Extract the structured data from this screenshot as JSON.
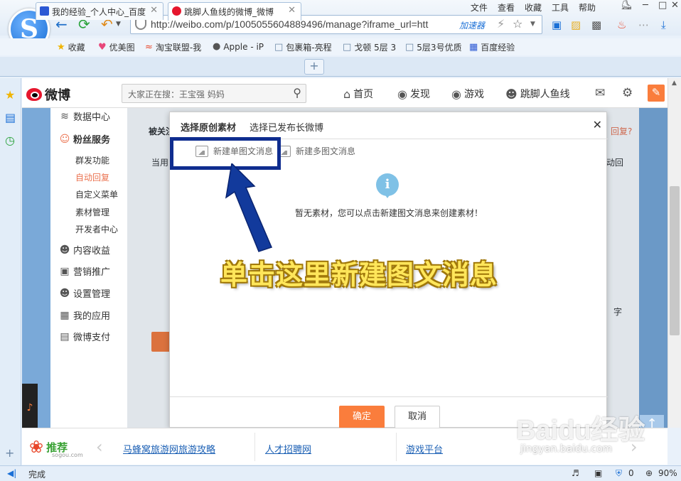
{
  "browser": {
    "menu": [
      "文件",
      "查看",
      "收藏",
      "工具",
      "帮助"
    ],
    "address": {
      "url": "http://weibo.com/p/1005055604889496/manage?iframe_url=htt",
      "accelerator": "加速器"
    },
    "bookmarks": [
      "收藏",
      "优美图",
      "淘宝联盟-我",
      "Apple - iP",
      "包裹箱-亮程",
      "戈顿 5层 3",
      "5层3号优质",
      "百度经验"
    ],
    "tabs": [
      {
        "title": "我的经验_个人中心_百度",
        "active": false
      },
      {
        "title": "跳脚人鱼线的微博_微博",
        "active": true
      }
    ],
    "status": {
      "text": "完成",
      "counter": "0",
      "zoom": "90%"
    }
  },
  "weibo": {
    "logo_text": "微博",
    "search_placeholder": "大家正在搜：王宝强 妈妈",
    "nav": {
      "home": "首页",
      "discover": "发现",
      "game": "游戏",
      "user": "跳脚人鱼线"
    },
    "menu": {
      "data_center": "数据中心",
      "fans_service": "粉丝服务",
      "fans_sub": [
        "群发功能",
        "自动回复",
        "自定义菜单",
        "素材管理",
        "开发者中心"
      ],
      "content_income": "内容收益",
      "marketing": "营销推广",
      "settings": "设置管理",
      "my_apps": "我的应用",
      "pay": "微博支付"
    },
    "behind": {
      "followed": "被关注",
      "current": "当用",
      "reply_q": "回复?",
      "auto_q": "动回",
      "chars": "字"
    }
  },
  "modal": {
    "tabs": [
      "选择原创素材",
      "选择已发布长微博"
    ],
    "new_single": "新建单图文消息",
    "new_multi": "新建多图文消息",
    "empty_message": "暂无素材，您可以点击新建图文消息来创建素材！",
    "ok": "确定",
    "cancel": "取消"
  },
  "annotation": {
    "callout": "单击这里新建图文消息",
    "box_color": "#0f2d8f",
    "text_color": "#ffe65a"
  },
  "recommend": {
    "title": "推荐",
    "source": "sogou.com",
    "links": [
      "马蜂窝旅游网旅游攻略",
      "人才招聘网",
      "游戏平台"
    ]
  },
  "watermark": {
    "line1": "Baidu经验",
    "line2": "jingyan.baidu.com"
  }
}
